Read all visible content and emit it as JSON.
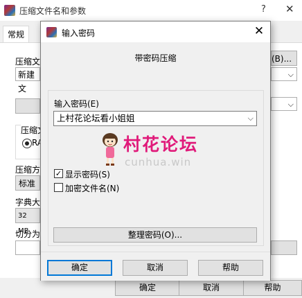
{
  "background_window": {
    "title": "压缩文件名和参数",
    "help_symbol": "?",
    "close_symbol": "✕",
    "tab_general": "常规",
    "label_archive": "压缩文",
    "field_archive": "新建文",
    "browse_partial": "(B)...",
    "label_format": "压缩文",
    "radio_rar": "RA",
    "label_method": "压缩方",
    "field_method": "标准",
    "label_dict": "字典大",
    "field_dict": "32 MB",
    "label_split": "切分为",
    "btn_ok": "确定",
    "btn_cancel": "取消",
    "btn_help": "帮助"
  },
  "dialog": {
    "title": "输入密码",
    "close_symbol": "✕",
    "heading": "带密码压缩",
    "password_label": "输入密码(E)",
    "password_value": "上村花论坛看小姐姐",
    "show_password": {
      "label": "显示密码(S)",
      "checked": true
    },
    "encrypt_names": {
      "label": "加密文件名(N)",
      "checked": false
    },
    "organize_button": "整理密码(O)...",
    "buttons": {
      "ok": "确定",
      "cancel": "取消",
      "help": "帮助"
    }
  },
  "watermark": {
    "text": "村花论坛",
    "subtext": "cunhua.win"
  },
  "icons": {
    "app": "winrar-books-icon",
    "dropdown": "chevron-down-icon",
    "check": "checkmark-icon"
  }
}
